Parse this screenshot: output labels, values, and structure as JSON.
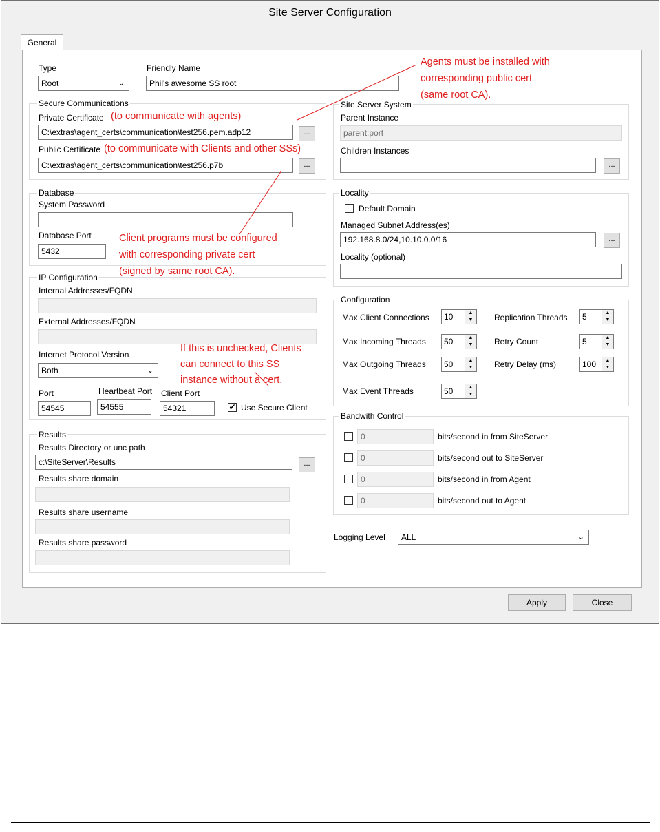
{
  "window": {
    "title": "Site Server Configuration"
  },
  "tabs": [
    {
      "label": "General"
    }
  ],
  "type": {
    "label": "Type",
    "value": "Root"
  },
  "friendly_name": {
    "label": "Friendly Name",
    "value": "Phil's awesome SS root"
  },
  "secure_comms": {
    "legend": "Secure Communications",
    "private_label": "Private Certificate",
    "private_value": "C:\\extras\\agent_certs\\communication\\test256.pem.adp12",
    "public_label": "Public Certificate",
    "public_value": "C:\\extras\\agent_certs\\communication\\test256.p7b",
    "browse": "..."
  },
  "site_server_system": {
    "legend": "Site Server System",
    "parent_label": "Parent Instance",
    "parent_placeholder": "parent:port",
    "children_label": "Children Instances",
    "browse": "..."
  },
  "database": {
    "legend": "Database",
    "password_label": "System Password",
    "port_label": "Database Port",
    "port_value": "5432"
  },
  "locality": {
    "legend": "Locality",
    "default_domain": "Default Domain",
    "subnet_label": "Managed Subnet Address(es)",
    "subnet_value": "192.168.8.0/24,10.10.0.0/16",
    "locality_label": "Locality (optional)",
    "browse": "..."
  },
  "ip_config": {
    "legend": "IP Configuration",
    "internal_label": "Internal Addresses/FQDN",
    "external_label": "External Addresses/FQDN",
    "ipv_label": "Internet Protocol Version",
    "ipv_value": "Both",
    "port_label": "Port",
    "port_value": "54545",
    "heartbeat_label": "Heartbeat Port",
    "heartbeat_value": "54555",
    "client_label": "Client Port",
    "client_value": "54321",
    "use_secure_label": "Use Secure Client",
    "use_secure_checked": true
  },
  "configuration": {
    "legend": "Configuration",
    "max_client_label": "Max Client Connections",
    "max_client_value": "10",
    "max_incoming_label": "Max Incoming Threads",
    "max_incoming_value": "50",
    "max_outgoing_label": "Max Outgoing Threads",
    "max_outgoing_value": "50",
    "max_event_label": "Max Event Threads",
    "max_event_value": "50",
    "replication_label": "Replication Threads",
    "replication_value": "5",
    "retry_count_label": "Retry Count",
    "retry_count_value": "5",
    "retry_delay_label": "Retry Delay (ms)",
    "retry_delay_value": "100"
  },
  "results": {
    "legend": "Results",
    "dir_label": "Results Directory or unc path",
    "dir_value": "c:\\SiteServer\\Results",
    "domain_label": "Results share domain",
    "username_label": "Results share username",
    "password_label": "Results share password",
    "browse": "..."
  },
  "bandwidth": {
    "legend": "Bandwith Control",
    "rows": [
      {
        "value": "0",
        "label": "bits/second in from SiteServer"
      },
      {
        "value": "0",
        "label": "bits/second out to SiteServer"
      },
      {
        "value": "0",
        "label": "bits/second in from Agent"
      },
      {
        "value": "0",
        "label": "bits/second out to Agent"
      }
    ]
  },
  "logging": {
    "label": "Logging Level",
    "value": "ALL"
  },
  "buttons": {
    "apply": "Apply",
    "close": "Close"
  },
  "annotations": {
    "private_note": "(to communicate with agents)",
    "public_note": "(to communicate with Clients and other SSs)",
    "agents_note": [
      "Agents must be installed with",
      "corresponding public cert",
      "(same root CA)."
    ],
    "client_note": [
      "Client programs must be configured",
      "with corresponding private cert",
      "(signed by same root CA)."
    ],
    "unchecked_note": [
      "If this is unchecked, Clients",
      "can connect to this SS",
      "instance without a cert."
    ]
  },
  "colors": {
    "annotation": "#e02020",
    "window_bg": "#f0f0f0"
  },
  "icons": {
    "spin": "updown-arrows-icon",
    "dropdown": "chevron-down-icon",
    "checkmark": "checkmark-icon"
  }
}
